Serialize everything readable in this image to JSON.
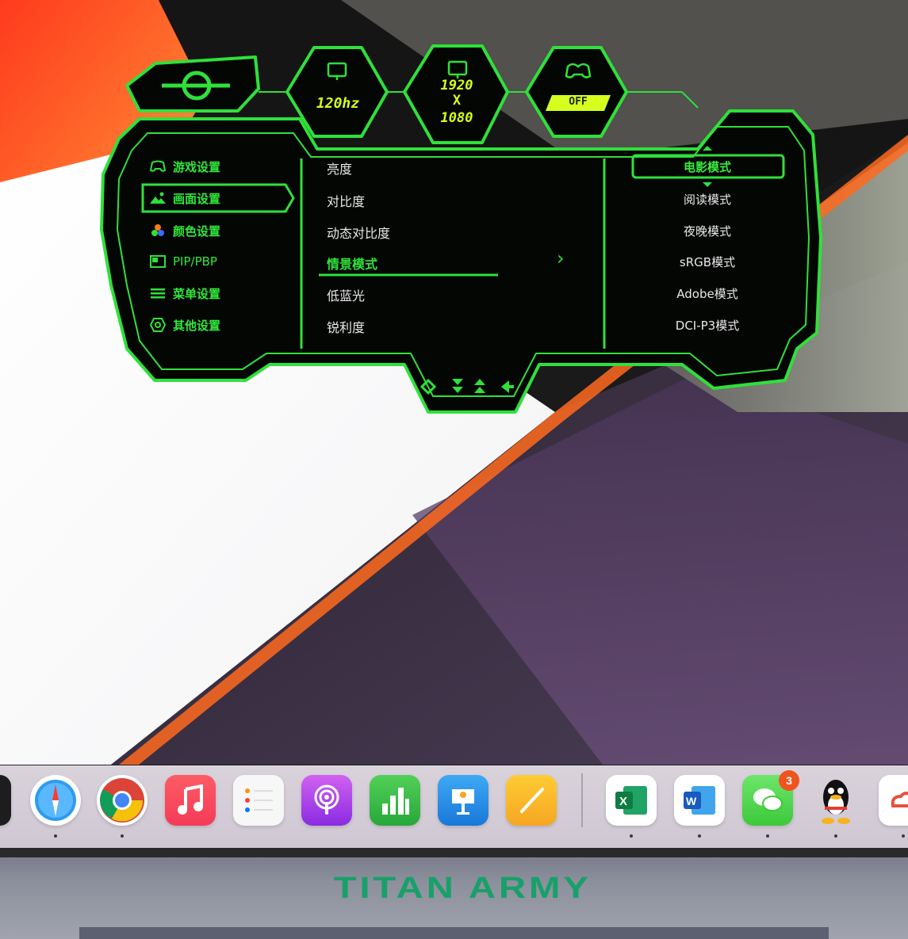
{
  "osd": {
    "status": {
      "refresh_rate": "120hz",
      "resolution_top": "1920",
      "resolution_x": "X",
      "resolution_bottom": "1080",
      "game_mode": "OFF"
    },
    "sidebar": [
      {
        "label": "游戏设置",
        "icon": "gamepad-icon",
        "active": false
      },
      {
        "label": "画面设置",
        "icon": "picture-icon",
        "active": true
      },
      {
        "label": "颜色设置",
        "icon": "color-dots-icon",
        "active": false
      },
      {
        "label": "PIP/PBP",
        "icon": "pip-icon",
        "active": false
      },
      {
        "label": "菜单设置",
        "icon": "menu-lines-icon",
        "active": false
      },
      {
        "label": "其他设置",
        "icon": "hexagon-settings-icon",
        "active": false
      }
    ],
    "menu": [
      {
        "label": "亮度",
        "active": false
      },
      {
        "label": "对比度",
        "active": false
      },
      {
        "label": "动态对比度",
        "active": false
      },
      {
        "label": "情景模式",
        "active": true
      },
      {
        "label": "低蓝光",
        "active": false
      },
      {
        "label": "锐利度",
        "active": false
      }
    ],
    "modes": [
      {
        "label": "电影模式",
        "active": true
      },
      {
        "label": "阅读模式",
        "active": false
      },
      {
        "label": "夜晚模式",
        "active": false
      },
      {
        "label": "sRGB模式",
        "active": false
      },
      {
        "label": "Adobe模式",
        "active": false
      },
      {
        "label": "DCI-P3模式",
        "active": false
      }
    ],
    "chevron": "›",
    "colors": {
      "neon_green": "#2fe03a",
      "yellow": "#d6ff1d",
      "panel": "#050805"
    }
  },
  "dock": {
    "apps": [
      {
        "name": "safari-icon"
      },
      {
        "name": "chrome-icon"
      },
      {
        "name": "music-icon"
      },
      {
        "name": "reminders-icon"
      },
      {
        "name": "podcasts-icon"
      },
      {
        "name": "numbers-icon"
      },
      {
        "name": "keynote-icon"
      },
      {
        "name": "pages-icon"
      },
      {
        "name": "excel-icon"
      },
      {
        "name": "word-icon"
      },
      {
        "name": "wechat-icon",
        "badge": "3"
      },
      {
        "name": "qq-icon"
      }
    ]
  },
  "brand": "TITAN ARMY"
}
